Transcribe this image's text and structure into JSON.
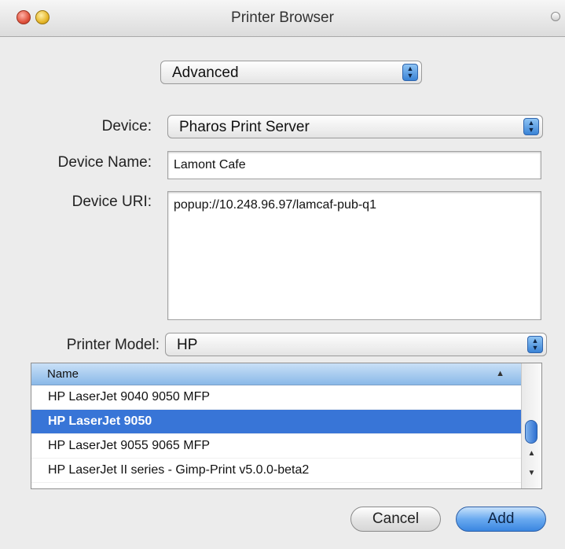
{
  "window": {
    "title": "Printer Browser"
  },
  "mode_popup": {
    "value": "Advanced"
  },
  "device": {
    "label": "Device:",
    "value": "Pharos Print Server"
  },
  "device_name": {
    "label": "Device Name:",
    "value": "Lamont Cafe"
  },
  "device_uri": {
    "label": "Device URI:",
    "value": "popup://10.248.96.97/lamcaf-pub-q1"
  },
  "printer_model": {
    "label": "Printer Model:",
    "value": "HP"
  },
  "model_table": {
    "column_header": "Name",
    "rows": [
      "HP LaserJet 9040 9050 MFP",
      "HP LaserJet 9050",
      "HP LaserJet 9055 9065 MFP",
      "HP LaserJet II series - Gimp-Print v5.0.0-beta2"
    ],
    "selected": "HP LaserJet 9050"
  },
  "buttons": {
    "cancel": "Cancel",
    "add": "Add"
  },
  "colors": {
    "selection": "#3875d7",
    "default_button": "#6aaaf0"
  }
}
